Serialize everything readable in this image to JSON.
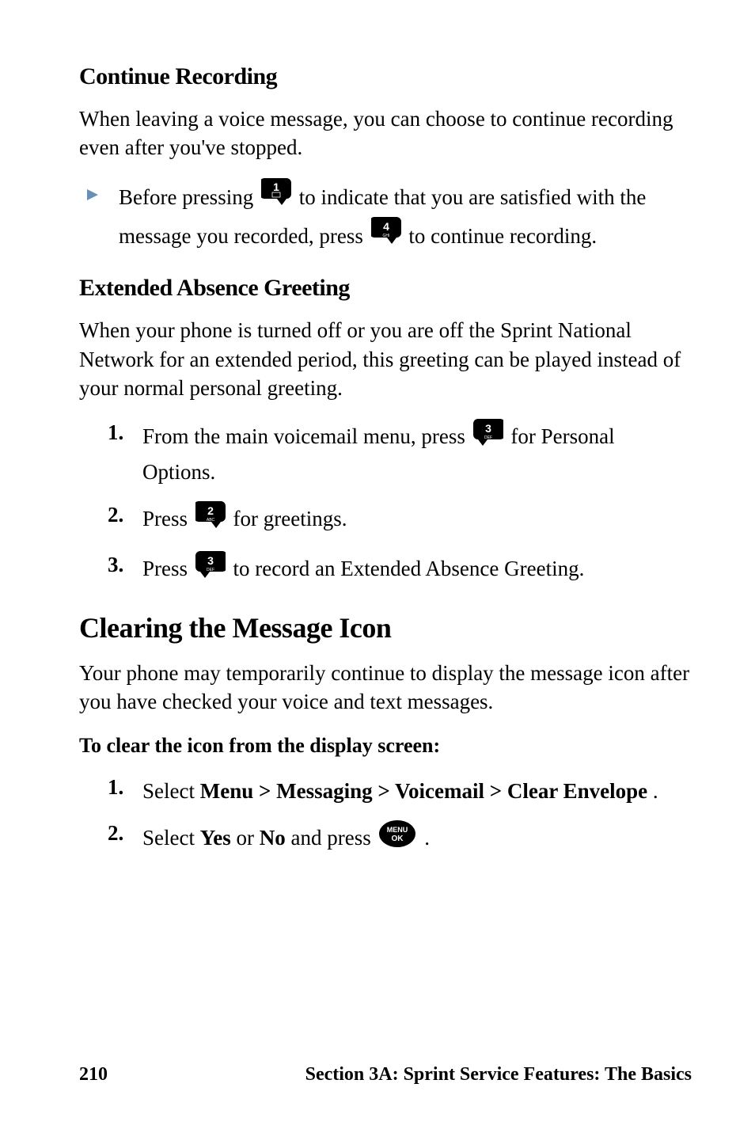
{
  "section1": {
    "heading": "Continue Recording",
    "para": "When leaving a voice message, you can choose to continue recording even after you've stopped.",
    "bullet": {
      "pre1": "Before pressing ",
      "mid1": " to indicate that you are satisfied with the message you recorded, press ",
      "post1": " to continue recording."
    }
  },
  "section2": {
    "heading": "Extended Absence Greeting",
    "para": "When your phone is turned off or you are off the Sprint National Network for an extended period, this greeting can be played instead of your normal personal greeting.",
    "items": [
      {
        "num": "1.",
        "pre": "From the main voicemail menu, press ",
        "post": " for Personal Options."
      },
      {
        "num": "2.",
        "pre": "Press ",
        "post": " for greetings."
      },
      {
        "num": "3.",
        "pre": "Press ",
        "post": " to record an Extended Absence Greeting."
      }
    ]
  },
  "section3": {
    "heading": "Clearing the Message Icon",
    "para": "Your phone may temporarily continue to display the message icon after you have checked your voice and text messages.",
    "subhead": "To clear the icon from the display screen:",
    "items": [
      {
        "num": "1.",
        "pre": "Select ",
        "bold": "Menu > Messaging > Voicemail > Clear Envelope",
        "post": "."
      },
      {
        "num": "2.",
        "pre": "Select ",
        "bold1": "Yes",
        "mid": " or ",
        "bold2": "No",
        "post": " and press ",
        "final": "."
      }
    ]
  },
  "footer": {
    "page": "210",
    "section": "Section 3A: Sprint Service Features: The Basics"
  },
  "keys": {
    "key1": "1",
    "key2": "2",
    "key3": "3",
    "key4": "4",
    "menu": "MENU",
    "ok": "OK"
  }
}
